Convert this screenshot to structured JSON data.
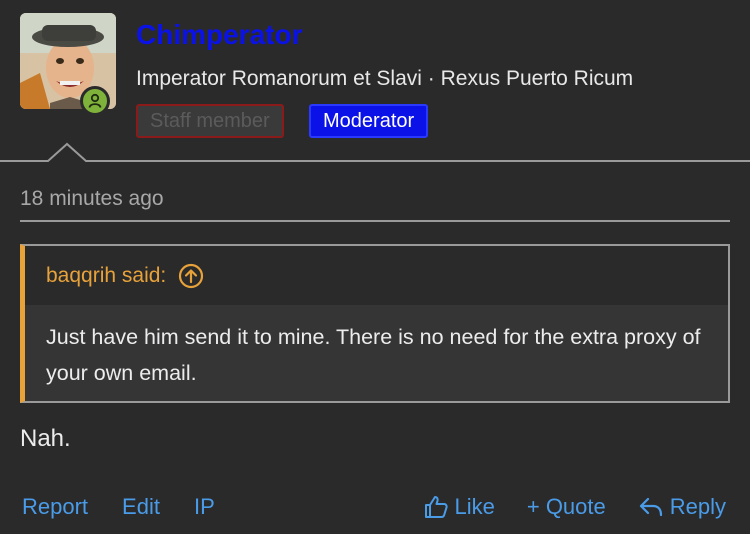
{
  "post": {
    "username": "Chimperator",
    "user_title": "Imperator Romanorum et Slavi · Rexus Puerto Ricum",
    "badges": {
      "staff": "Staff member",
      "moderator": "Moderator"
    },
    "timestamp": "18 minutes ago",
    "quote": {
      "author_label": "baqqrih said:",
      "text": "Just have him send it to mine. There is no need for the extra proxy of your own email."
    },
    "message": "Nah."
  },
  "actions": {
    "report": "Report",
    "edit": "Edit",
    "ip": "IP",
    "like": "Like",
    "quote": "+ Quote",
    "reply": "Reply"
  },
  "colors": {
    "username": "#0b12e8",
    "moderator_badge": "#0b12e8",
    "staff_badge_border": "#8b1a1a",
    "quote_accent": "#e8a23a",
    "link": "#4a9be8",
    "online": "#7fb23a"
  },
  "icons": {
    "online": "user-online-icon",
    "quote_jump": "arrow-up-circle-icon",
    "like": "thumbs-up-icon",
    "reply": "reply-arrow-icon"
  }
}
